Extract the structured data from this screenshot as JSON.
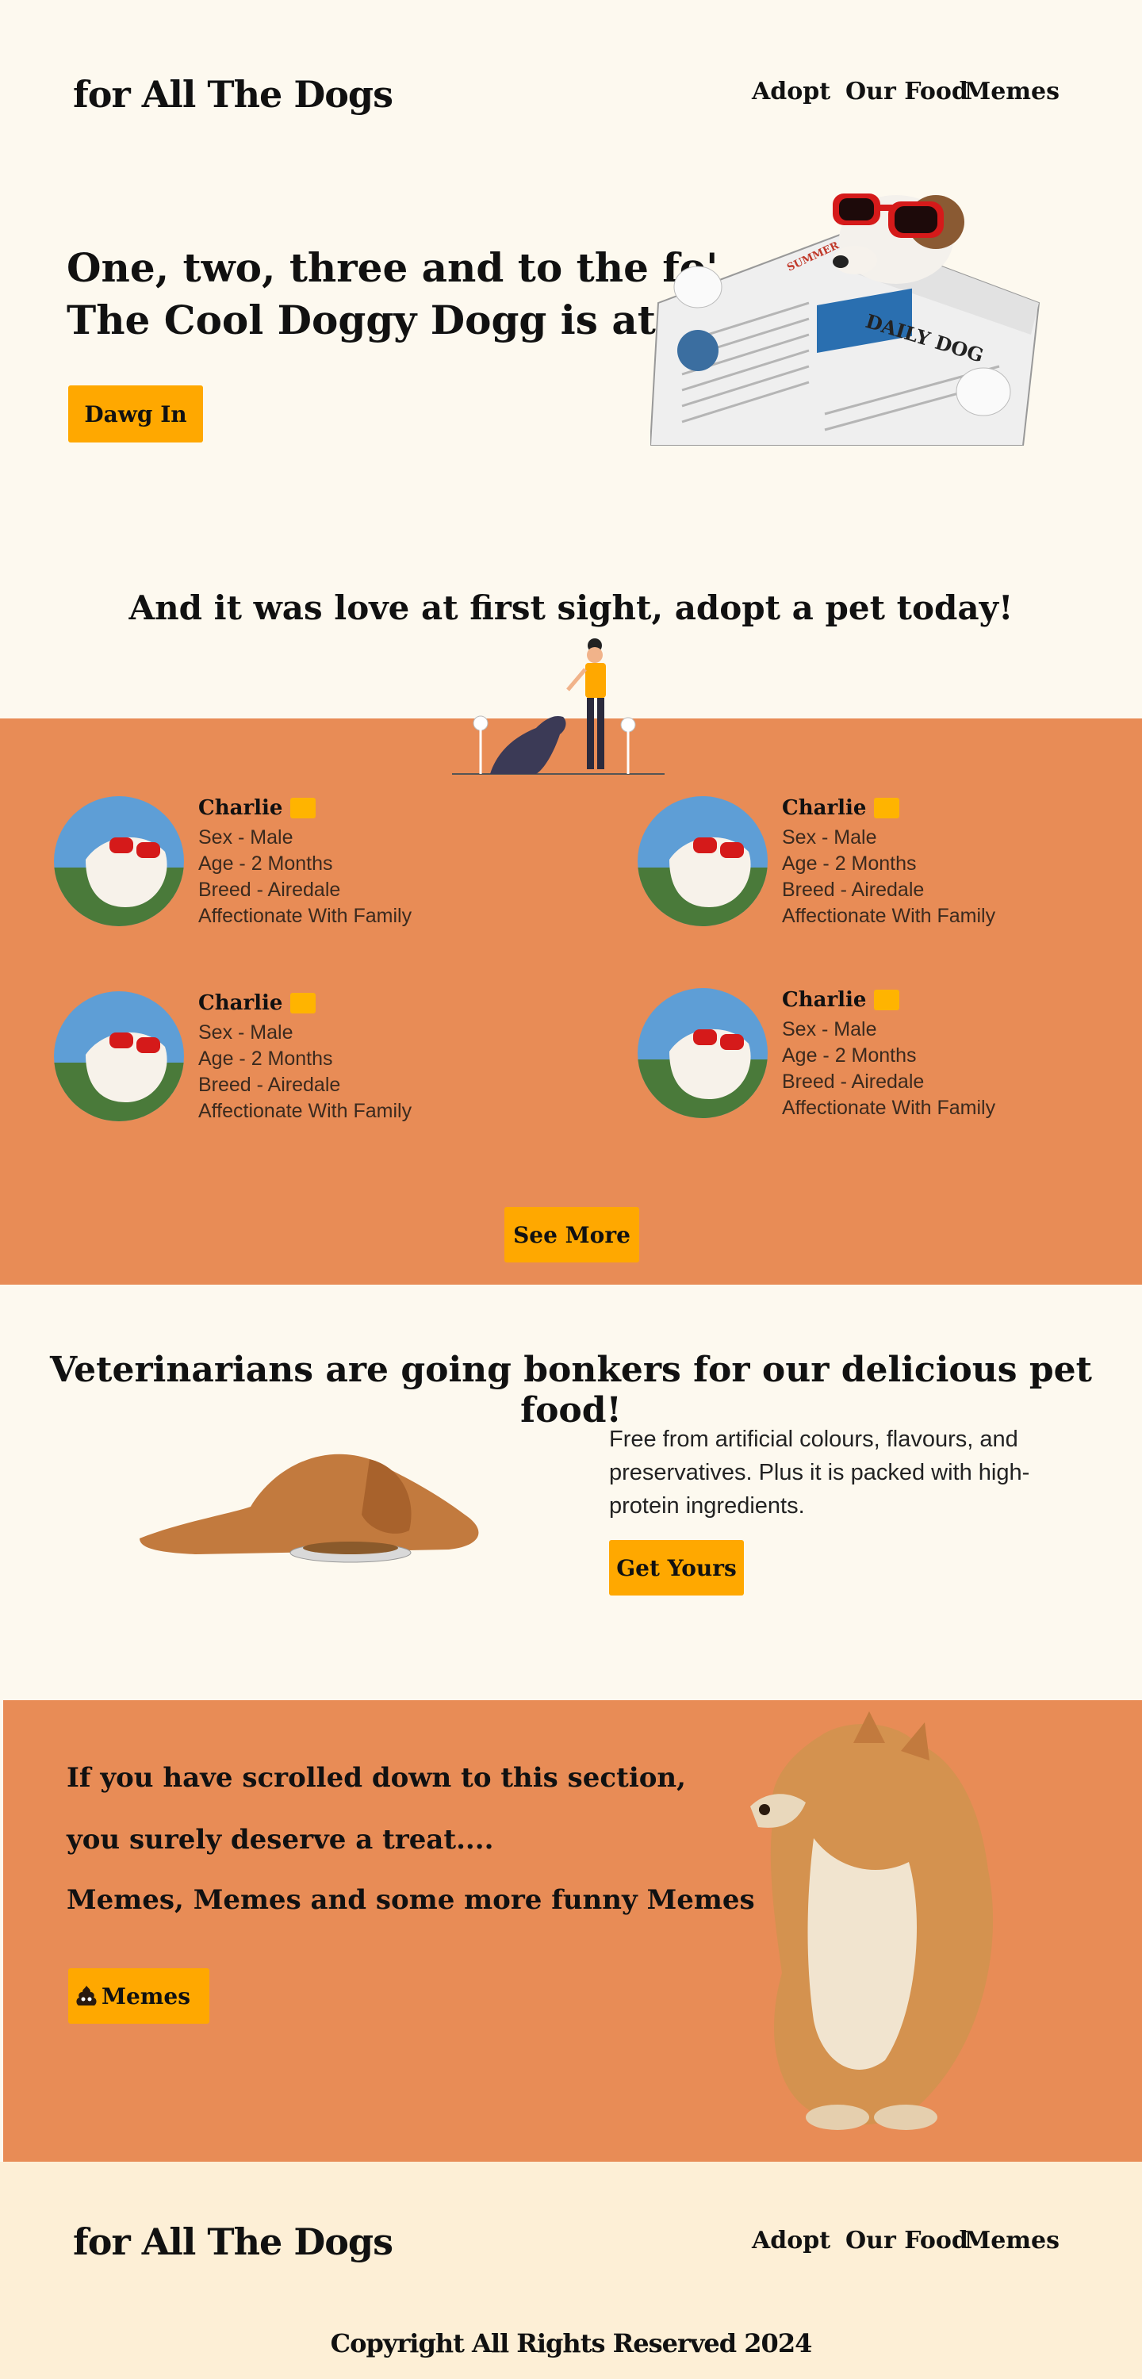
{
  "header": {
    "logo": "for All The Dogs",
    "nav": [
      "Adopt",
      "Our Food",
      "Memes"
    ]
  },
  "hero": {
    "line1": "One, two, three and to the fo'",
    "line2": "The Cool Doggy Dogg is at the do'",
    "cta": "Dawg In",
    "newspaper_masthead": "DAILY DOG",
    "newspaper_edition": "SUMMER EDITION",
    "image_icon": "dog-reading-newspaper-illustration"
  },
  "adopt": {
    "title": "And it was love at first sight, adopt a pet today!",
    "pets": [
      {
        "name": "Charlie",
        "sex": "Sex - Male",
        "age": "Age - 2 Months",
        "breed": "Breed - Airedale",
        "trait": "Affectionate With Family"
      },
      {
        "name": "Charlie",
        "sex": "Sex - Male",
        "age": "Age - 2 Months",
        "breed": "Breed - Airedale",
        "trait": "Affectionate With Family"
      },
      {
        "name": "Charlie",
        "sex": "Sex - Male",
        "age": "Age - 2 Months",
        "breed": "Breed - Airedale",
        "trait": "Affectionate With Family"
      },
      {
        "name": "Charlie",
        "sex": "Sex - Male",
        "age": "Age - 2 Months",
        "breed": "Breed - Airedale",
        "trait": "Affectionate With Family"
      }
    ],
    "see_more": "See More"
  },
  "food": {
    "title": "Veterinarians are going bonkers for our delicious pet food!",
    "description": "Free from artificial colours, flavours, and preservatives. Plus it is packed with high-protein ingredients.",
    "cta": "Get Yours"
  },
  "memes": {
    "line1": "If you have scrolled down to this section,",
    "line2": "you surely deserve a treat....",
    "line3": "Memes, Memes and some more funny Memes",
    "cta": "Memes",
    "cta_icon": "poop-emoji-icon"
  },
  "footer": {
    "logo": "for All The Dogs",
    "nav": [
      "Adopt",
      "Our Food",
      "Memes"
    ],
    "copyright": "Copyright All Rights Reserved 2024"
  },
  "colors": {
    "background": "#fdf9ef",
    "accent_band": "#e88c56",
    "button": "#ffa800",
    "footer_bg": "#fdefd6"
  }
}
